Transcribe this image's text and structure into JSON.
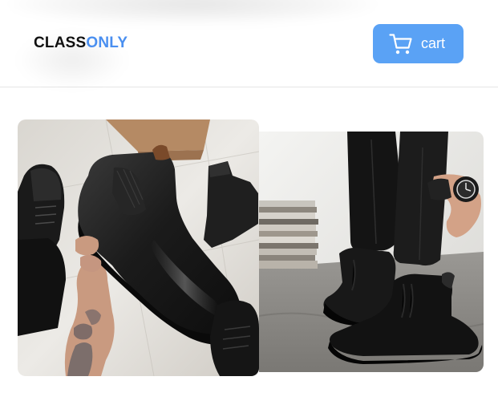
{
  "header": {
    "logo_part1": "CLASS",
    "logo_part2": "ONLY",
    "cart_label": "cart",
    "cart_icon": "cart-icon"
  },
  "colors": {
    "logo_dark": "#111111",
    "logo_accent": "#4a8ff0",
    "cart_button": "#5aa2f5",
    "divider": "#e6e6e6"
  },
  "products": [
    {
      "name": "black-leather-chelsea-boot",
      "image": "photo"
    },
    {
      "name": "black-suede-chelsea-boot",
      "image": "photo"
    }
  ]
}
